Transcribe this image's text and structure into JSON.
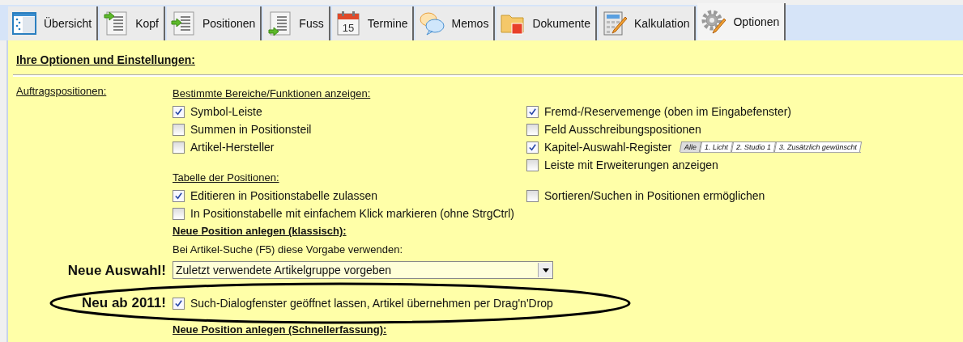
{
  "tabs": [
    {
      "label": "Übersicht",
      "kind": "overview",
      "selected": false
    },
    {
      "label": "Kopf",
      "kind": "header",
      "selected": false
    },
    {
      "label": "Positionen",
      "kind": "positions",
      "selected": false
    },
    {
      "label": "Fuss",
      "kind": "footer",
      "selected": false
    },
    {
      "label": "Termine",
      "kind": "calendar",
      "calendar_day": "15",
      "selected": false
    },
    {
      "label": "Memos",
      "kind": "chat",
      "selected": false
    },
    {
      "label": "Dokumente",
      "kind": "folder",
      "selected": false
    },
    {
      "label": "Kalkulation",
      "kind": "calculator",
      "selected": false
    },
    {
      "label": "Optionen",
      "kind": "gear",
      "selected": true
    }
  ],
  "heading": "Ihre Optionen und Einstellungen:",
  "section_label": "Auftragspositionen:",
  "display_options": {
    "title": "Bestimmte Bereiche/Funktionen anzeigen:",
    "left": [
      {
        "label": "Symbol-Leiste",
        "checked": true
      },
      {
        "label": "Summen in Positionsteil",
        "checked": false
      },
      {
        "label": "Artikel-Hersteller",
        "checked": false
      }
    ],
    "right": [
      {
        "label": "Fremd-/Reservemenge (oben im Eingabefenster)",
        "checked": true
      },
      {
        "label": "Feld Ausschreibungspositionen",
        "checked": false
      },
      {
        "label": "Kapitel-Auswahl-Register",
        "checked": true,
        "chapter_tabs": [
          {
            "label": "Alle",
            "selected": true
          },
          {
            "label": "1. Licht",
            "selected": false
          },
          {
            "label": "2. Studio 1",
            "selected": false
          },
          {
            "label": "3. Zusätzlich gewünscht",
            "selected": false
          }
        ]
      },
      {
        "label": "Leiste mit Erweiterungen anzeigen",
        "checked": false
      }
    ]
  },
  "table_options": {
    "title": "Tabelle der Positionen:",
    "left": [
      {
        "label": "Editieren in Positionstabelle zulassen",
        "checked": true
      },
      {
        "label": "In Positionstabelle mit einfachem Klick markieren (ohne StrgCtrl)",
        "checked": false
      }
    ],
    "right": [
      {
        "label": "Sortieren/Suchen in Positionen ermöglichen",
        "checked": false
      }
    ]
  },
  "new_position": {
    "title": "Neue Position anlegen (klassisch):",
    "hint": "Bei Artikel-Suche (F5) diese Vorgabe verwenden:",
    "callout_dropdown": "Neue Auswahl!",
    "dropdown": {
      "value": "Zuletzt verwendete Artikelgruppe vorgeben"
    },
    "callout_checkbox": "Neu ab 2011!",
    "checkbox": {
      "label": "Such-Dialogfenster geöffnet lassen, Artikel übernehmen per Drag'n'Drop",
      "checked": true
    }
  },
  "next_section": "Neue Position anlegen (Schnellerfassung):"
}
